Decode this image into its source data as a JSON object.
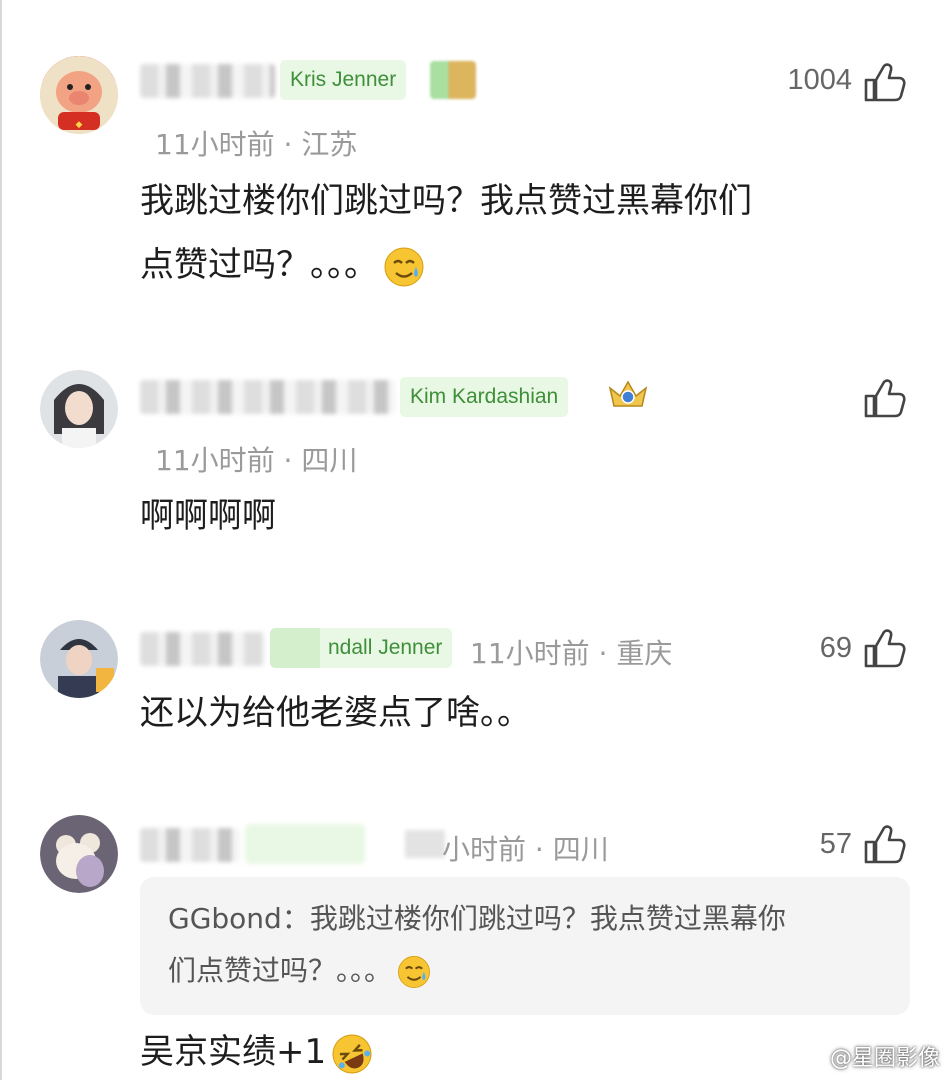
{
  "comments": [
    {
      "badge": "Kris Jenner",
      "meta": "11小时前 · 江苏",
      "likes": "1004",
      "text_line1": "我跳过楼你们跳过吗？我点赞过黑幕你们",
      "text_line2": "点赞过吗？。。。"
    },
    {
      "badge": "Kim Kardashian",
      "meta": "11小时前 · 四川",
      "text": "啊啊啊啊"
    },
    {
      "badge": "ndall Jenner",
      "meta": "11小时前 · 重庆",
      "likes": "69",
      "text": "还以为给他老婆点了啥。。"
    },
    {
      "meta": "小时前 · 四川",
      "likes": "57",
      "quote_line1": "GGbond：我跳过楼你们跳过吗？我点赞过黑幕你",
      "quote_line2": "们点赞过吗？。。。",
      "text": "吴京实绩+1"
    }
  ],
  "watermark": "@星圈影像"
}
